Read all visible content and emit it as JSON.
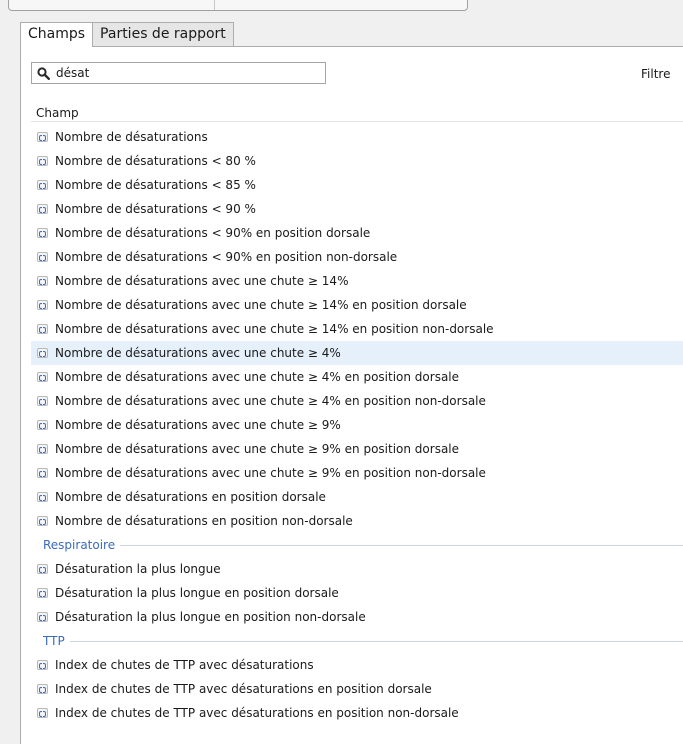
{
  "tabs": [
    {
      "label": "Champs"
    },
    {
      "label": "Parties de rapport"
    }
  ],
  "search": {
    "value": "désat"
  },
  "filter_label": "Filtre",
  "column_header": "Champ",
  "items": [
    "Nombre de désaturations",
    "Nombre de désaturations < 80 %",
    "Nombre de désaturations < 85 %",
    "Nombre de désaturations < 90 %",
    "Nombre de désaturations < 90% en position dorsale",
    "Nombre de désaturations < 90% en position non-dorsale",
    "Nombre de désaturations avec une chute ≥ 14%",
    "Nombre de désaturations avec une chute ≥ 14% en position dorsale",
    "Nombre de désaturations avec une chute ≥ 14% en position non-dorsale",
    "Nombre de désaturations avec une chute ≥ 4%",
    "Nombre de désaturations avec une chute ≥ 4% en position dorsale",
    "Nombre de désaturations avec une chute ≥ 4% en position non-dorsale",
    "Nombre de désaturations avec une chute ≥ 9%",
    "Nombre de désaturations avec une chute ≥ 9% en position dorsale",
    "Nombre de désaturations avec une chute ≥ 9% en position non-dorsale",
    "Nombre de désaturations en position dorsale",
    "Nombre de désaturations en position non-dorsale"
  ],
  "groups": [
    {
      "title": "Respiratoire",
      "items": [
        "Désaturation la plus longue",
        "Désaturation la plus longue en position dorsale",
        "Désaturation la plus longue en position non-dorsale"
      ]
    },
    {
      "title": "TTP",
      "items": [
        "Index de chutes de TTP avec désaturations",
        "Index de chutes de TTP avec désaturations en position dorsale",
        "Index de chutes de TTP avec désaturations en position non-dorsale"
      ]
    }
  ],
  "selected_item": "Nombre de désaturations avec une chute ≥ 4%",
  "colors": {
    "group_title": "#3b6bbd",
    "selection": "#e6f0fa",
    "field_icon": "#3c6fbf"
  },
  "icons": {
    "search": "magnifier-icon",
    "field": "field-code-icon"
  }
}
